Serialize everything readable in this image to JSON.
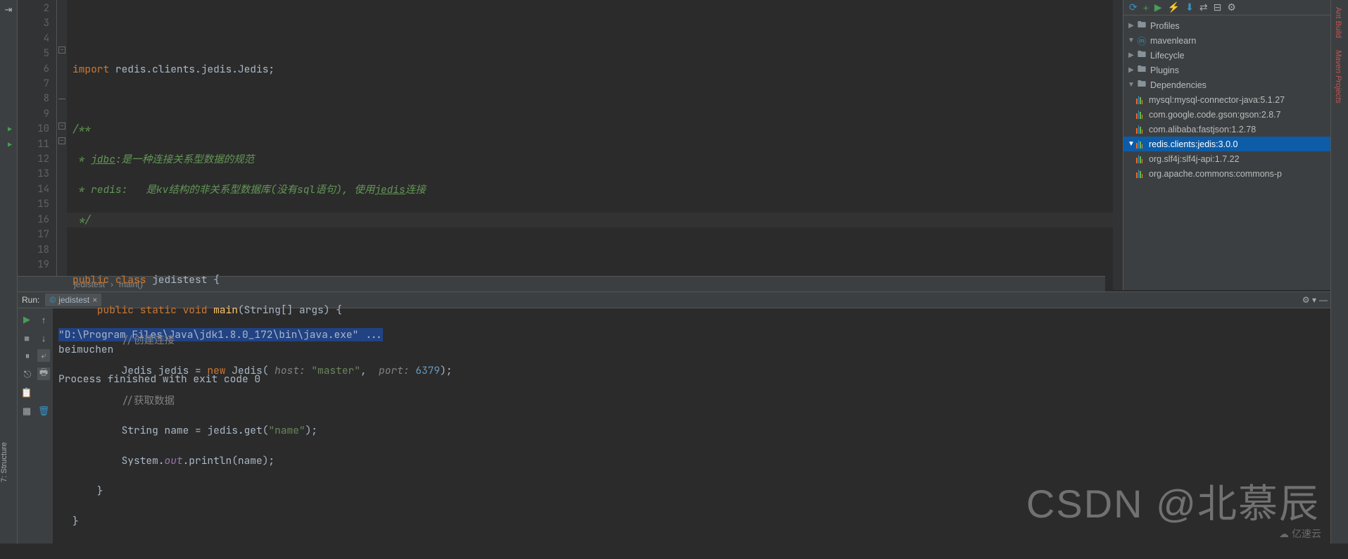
{
  "gutter": {
    "lines": [
      "2",
      "3",
      "4",
      "5",
      "6",
      "7",
      "8",
      "9",
      "10",
      "11",
      "12",
      "13",
      "14",
      "15",
      "16",
      "17",
      "18",
      "19"
    ]
  },
  "code": {
    "l2": "",
    "l3_a": "import ",
    "l3_b": "redis.clients.jedis.Jedis;",
    "l5": "/**",
    "l6_a": " * ",
    "l6_b": "jdbc",
    "l6_c": ":是一种连接关系型数据的规范",
    "l7_a": " * redis:   是kv结构的非关系型数据库(没有sql语句), 使用",
    "l7_b": "jedis",
    "l7_c": "连接",
    "l8": " */",
    "l10_a": "public class ",
    "l10_b": "jedistest {",
    "l11_a": "    public static void ",
    "l11_b": "main",
    "l11_c": "(String[] args) {",
    "l12": "        //创建连接",
    "l13_a": "        Jedis jedis = ",
    "l13_b": "new ",
    "l13_c": "Jedis( ",
    "l13_d": "host: ",
    "l13_e": "\"master\"",
    "l13_f": ",  ",
    "l13_g": "port: ",
    "l13_h": "6379",
    "l13_i": ");",
    "l14": "        //获取数据",
    "l15_a": "        String name = jedis.get(",
    "l15_b": "\"name\"",
    "l15_c": ");",
    "l16_a": "        System.",
    "l16_b": "out",
    "l16_c": ".println(name);",
    "l17": "    }",
    "l18": "}"
  },
  "breadcrumb": {
    "a": "jedistest",
    "b": "main()"
  },
  "maven": {
    "profiles": "Profiles",
    "root": "mavenlearn",
    "lifecycle": "Lifecycle",
    "plugins": "Plugins",
    "deps": "Dependencies",
    "d1": "mysql:mysql-connector-java:5.1.27",
    "d2": "com.google.code.gson:gson:2.8.7",
    "d3": "com.alibaba:fastjson:1.2.78",
    "d4": "redis.clients:jedis:3.0.0",
    "d4a": "org.slf4j:slf4j-api:1.7.22",
    "d4b": "org.apache.commons:commons-p"
  },
  "run": {
    "label": "Run:",
    "tab": "jedistest",
    "out1": "\"D:\\Program Files\\Java\\jdk1.8.0_172\\bin\\java.exe\" ...",
    "out2": "beimuchen",
    "out3": "Process finished with exit code 0"
  },
  "rightbars": {
    "build": "Ant Build",
    "mvn": "Maven Projects"
  },
  "leftbar": {
    "structure": "7: Structure"
  },
  "watermark": "CSDN @北慕辰",
  "watermark2": "亿速云"
}
